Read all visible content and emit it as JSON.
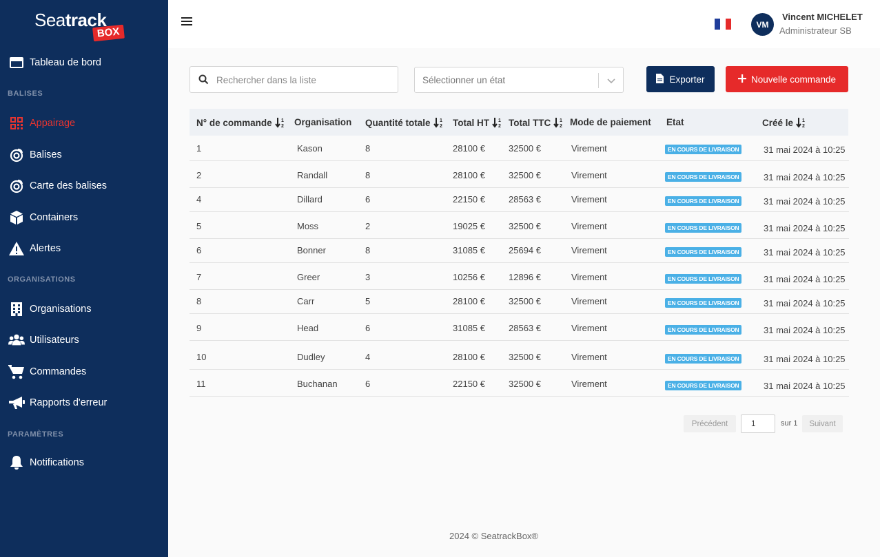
{
  "brand": {
    "logo_word_light": "Sea",
    "logo_word_bold": "track",
    "logo_box": "BOX"
  },
  "sidebar": {
    "items": [
      {
        "label": "Tableau de bord",
        "icon": "dashboard-icon"
      },
      {
        "label": "Appairage",
        "icon": "qr-code-icon",
        "active": true
      },
      {
        "label": "Balises",
        "icon": "beacon-icon"
      },
      {
        "label": "Carte des balises",
        "icon": "beacon-map-icon"
      },
      {
        "label": "Containers",
        "icon": "container-box-icon"
      },
      {
        "label": "Alertes",
        "icon": "warning-icon"
      },
      {
        "label": "Organisations",
        "icon": "building-icon"
      },
      {
        "label": "Utilisateurs",
        "icon": "users-icon"
      },
      {
        "label": "Commandes",
        "icon": "cart-icon"
      },
      {
        "label": "Rapports d'erreur",
        "icon": "megaphone-icon"
      },
      {
        "label": "Notifications",
        "icon": "bell-icon"
      }
    ],
    "sections": [
      "BALISES",
      "ORGANISATIONS",
      "PARAMÈTRES"
    ]
  },
  "header": {
    "user_initials": "VM",
    "user_name": "Vincent MICHELET",
    "user_role": "Administrateur SB"
  },
  "toolbar": {
    "search_placeholder": "Rechercher dans la liste",
    "status_placeholder": "Sélectionner un état",
    "export_label": "Exporter",
    "new_order_label": "Nouvelle commande"
  },
  "table": {
    "columns": [
      "N° de commande",
      "Organisation",
      "Quantité totale",
      "Total HT",
      "Total TTC",
      "Mode de paiement",
      "Etat",
      "Créé le"
    ],
    "rows": [
      {
        "id": "1",
        "org": "Kason",
        "qty": "8",
        "ht": "28100 €",
        "ttc": "32500 €",
        "pay": "Virement",
        "status": "EN COURS DE LIVRAISON",
        "created": "31 mai 2024 à 10:25"
      },
      {
        "id": "2",
        "org": "Randall",
        "qty": "8",
        "ht": "28100 €",
        "ttc": "32500 €",
        "pay": "Virement",
        "status": "EN COURS DE LIVRAISON",
        "created": "31 mai 2024 à 10:25"
      },
      {
        "id": "4",
        "org": "Dillard",
        "qty": "6",
        "ht": "22150 €",
        "ttc": "28563 €",
        "pay": "Virement",
        "status": "EN COURS DE LIVRAISON",
        "created": "31 mai 2024 à 10:25"
      },
      {
        "id": "5",
        "org": "Moss",
        "qty": "2",
        "ht": "19025 €",
        "ttc": "32500 €",
        "pay": "Virement",
        "status": "EN COURS DE LIVRAISON",
        "created": "31 mai 2024 à 10:25"
      },
      {
        "id": "6",
        "org": "Bonner",
        "qty": "8",
        "ht": "31085 €",
        "ttc": "25694 €",
        "pay": "Virement",
        "status": "EN COURS DE LIVRAISON",
        "created": "31 mai 2024 à 10:25"
      },
      {
        "id": "7",
        "org": "Greer",
        "qty": "3",
        "ht": "10256 €",
        "ttc": "12896 €",
        "pay": "Virement",
        "status": "EN COURS DE LIVRAISON",
        "created": "31 mai 2024 à 10:25"
      },
      {
        "id": "8",
        "org": "Carr",
        "qty": "5",
        "ht": "28100 €",
        "ttc": "32500 €",
        "pay": "Virement",
        "status": "EN COURS DE LIVRAISON",
        "created": "31 mai 2024 à 10:25"
      },
      {
        "id": "9",
        "org": "Head",
        "qty": "6",
        "ht": "31085 €",
        "ttc": "28563 €",
        "pay": "Virement",
        "status": "EN COURS DE LIVRAISON",
        "created": "31 mai 2024 à 10:25"
      },
      {
        "id": "10",
        "org": "Dudley",
        "qty": "4",
        "ht": "28100 €",
        "ttc": "32500 €",
        "pay": "Virement",
        "status": "EN COURS DE LIVRAISON",
        "created": "31 mai 2024 à 10:25"
      },
      {
        "id": "11",
        "org": "Buchanan",
        "qty": "6",
        "ht": "22150 €",
        "ttc": "32500 €",
        "pay": "Virement",
        "status": "EN COURS DE LIVRAISON",
        "created": "31 mai 2024 à 10:25"
      }
    ]
  },
  "pagination": {
    "prev_label": "Précédent",
    "current_page": "1",
    "of_label": "sur 1",
    "next_label": "Suivant"
  },
  "footer": {
    "text": "2024 © SeatrackBox®"
  },
  "colors": {
    "sidebar_bg": "#0e2e5c",
    "accent_red": "#e62a2a",
    "badge_blue": "#4ab0e6"
  }
}
